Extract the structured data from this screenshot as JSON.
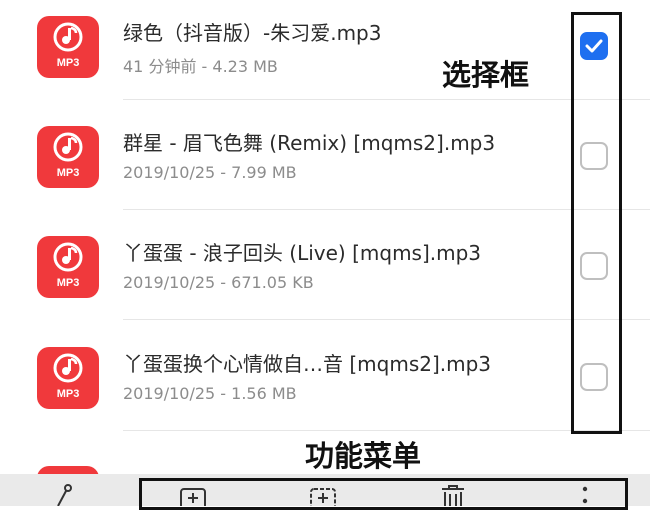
{
  "files": [
    {
      "title": "绿色（抖音版）-朱习爱.mp3",
      "meta": "41 分钟前 - 4.23 MB",
      "badge": "MP3",
      "checked": true
    },
    {
      "title": "群星 - 眉飞色舞 (Remix) [mqms2].mp3",
      "meta": "2019/10/25 - 7.99 MB",
      "badge": "MP3",
      "checked": false
    },
    {
      "title": "丫蛋蛋 - 浪子回头 (Live) [mqms].mp3",
      "meta": "2019/10/25 - 671.05 KB",
      "badge": "MP3",
      "checked": false
    },
    {
      "title": "丫蛋蛋换个心情做自…音 [mqms2].mp3",
      "meta": "2019/10/25 - 1.56 MB",
      "badge": "MP3",
      "checked": false
    }
  ],
  "annotations": {
    "select_box": "选择框",
    "function_menu": "功能菜单"
  },
  "colors": {
    "icon_red": "#f0393c",
    "check_blue": "#1e6ff0"
  },
  "toolbar_icons": [
    "share-icon",
    "add-file-icon",
    "add-folder-icon",
    "trash-icon",
    "more-vertical-icon"
  ]
}
